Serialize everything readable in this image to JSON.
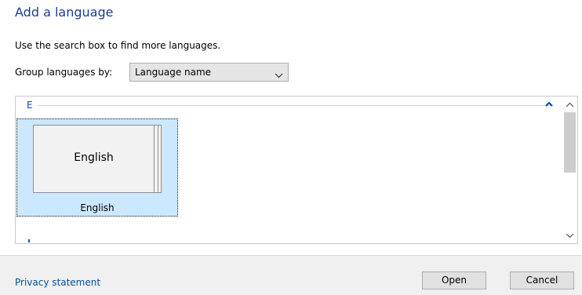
{
  "dialog": {
    "title": "Add a language",
    "hint": "Use the search box to find more languages.",
    "group_by_label": "Group languages by:",
    "group_by_value": "Language name"
  },
  "list": {
    "group_letter": "E",
    "items": [
      {
        "tile_text": "English",
        "caption": "English",
        "selected": true
      }
    ]
  },
  "icons": {
    "dropdown": "chevron-down-icon",
    "collapse": "chevron-up-icon",
    "scroll_up": "scroll-up-arrow-icon",
    "scroll_down": "scroll-down-arrow-icon"
  },
  "footer": {
    "privacy_link": "Privacy statement",
    "open_label": "Open",
    "cancel_label": "Cancel"
  },
  "colors": {
    "title": "#1e3d8f",
    "selection": "#cce8ff",
    "link": "#0050a0",
    "group_header": "#0b3ebf"
  }
}
